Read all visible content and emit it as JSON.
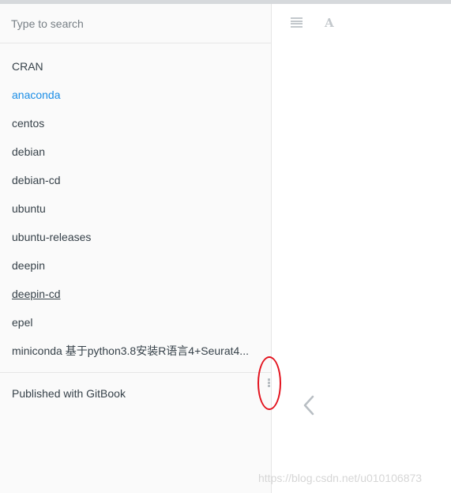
{
  "search": {
    "placeholder": "Type to search"
  },
  "sidebar": {
    "items": [
      {
        "label": "CRAN"
      },
      {
        "label": "anaconda"
      },
      {
        "label": "centos"
      },
      {
        "label": "debian"
      },
      {
        "label": "debian-cd"
      },
      {
        "label": "ubuntu"
      },
      {
        "label": "ubuntu-releases"
      },
      {
        "label": "deepin"
      },
      {
        "label": "deepin-cd"
      },
      {
        "label": "epel"
      },
      {
        "label": "miniconda 基于python3.8安装R语言4+Seurat4..."
      }
    ],
    "footer_link": "Published with GitBook"
  },
  "toolbar": {
    "menu_icon": "hamburger-icon",
    "font_icon": "font-settings-icon"
  },
  "navigation": {
    "prev_icon": "chevron-left-icon"
  },
  "watermark": "https://blog.csdn.net/u010106873",
  "colors": {
    "active_link": "#1a8de6",
    "text": "#364149",
    "annotation": "#e3121d",
    "icon": "#c3c8cc"
  }
}
